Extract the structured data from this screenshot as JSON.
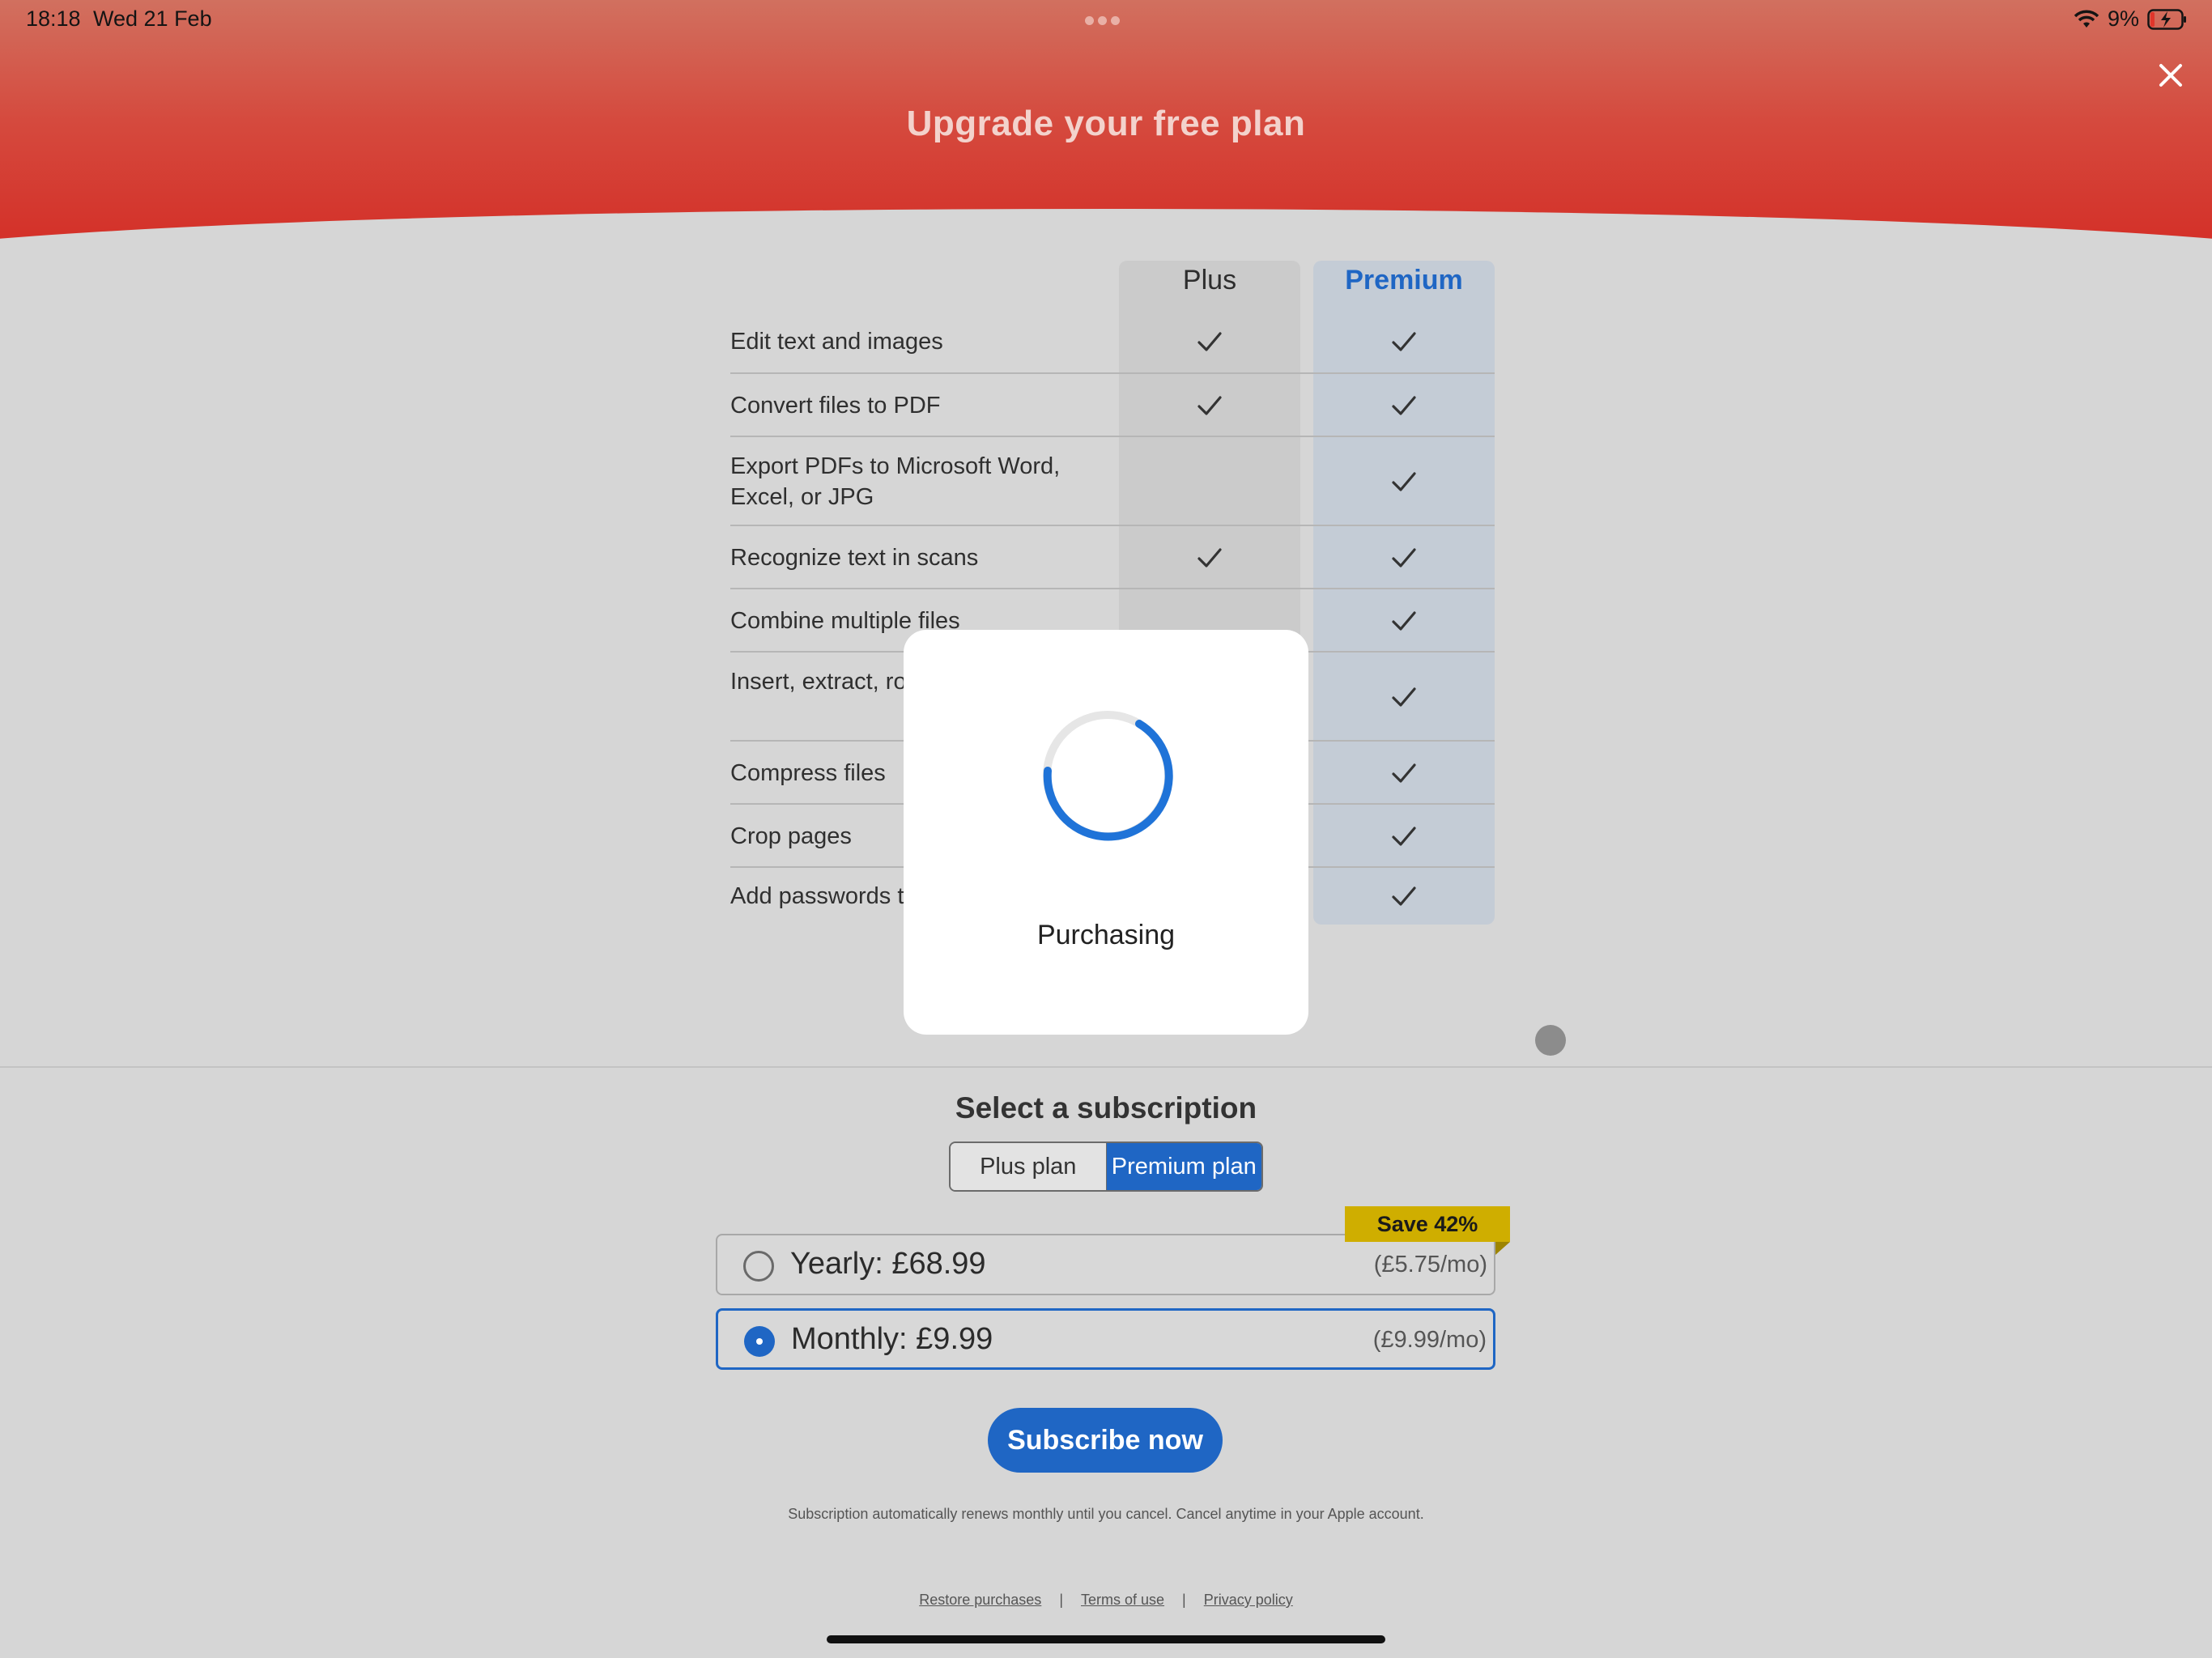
{
  "status_bar": {
    "time": "18:18",
    "date": "Wed 21 Feb",
    "battery": "9%"
  },
  "header": {
    "title": "Upgrade your free plan",
    "accent_color": "#d42b24"
  },
  "comparison": {
    "columns": {
      "plus": "Plus",
      "premium": "Premium"
    },
    "rows": [
      {
        "label": "Edit text and images",
        "plus": true,
        "premium": true
      },
      {
        "label": "Convert files to PDF",
        "plus": true,
        "premium": true
      },
      {
        "label": "Export PDFs to Microsoft Word, Excel, or JPG",
        "plus": false,
        "premium": true
      },
      {
        "label": "Recognize text in scans",
        "plus": true,
        "premium": true
      },
      {
        "label": "Combine multiple files",
        "plus": false,
        "premium": true
      },
      {
        "label": "Insert, extract, rot reorder pages",
        "plus": false,
        "premium": true
      },
      {
        "label": "Compress files",
        "plus": false,
        "premium": true
      },
      {
        "label": "Crop pages",
        "plus": false,
        "premium": true
      },
      {
        "label": "Add passwords to",
        "plus": false,
        "premium": true
      }
    ]
  },
  "subscription": {
    "title": "Select a subscription",
    "plan_toggle": {
      "plus": "Plus plan",
      "premium": "Premium plan",
      "selected": "premium"
    },
    "save_badge": "Save 42%",
    "options": [
      {
        "label": "Yearly: £68.99",
        "per_month": "(£5.75/mo)",
        "selected": false
      },
      {
        "label": "Monthly: £9.99",
        "per_month": "(£9.99/mo)",
        "selected": true
      }
    ],
    "subscribe_button": "Subscribe now",
    "disclaimer": "Subscription automatically renews monthly until you cancel. Cancel anytime in your Apple account.",
    "links": {
      "restore": "Restore purchases",
      "terms": "Terms of use",
      "privacy": "Privacy policy",
      "separator": "|"
    }
  },
  "modal": {
    "text": "Purchasing"
  },
  "colors": {
    "brand_blue": "#1f66c4",
    "badge_gold": "#cfae00"
  }
}
